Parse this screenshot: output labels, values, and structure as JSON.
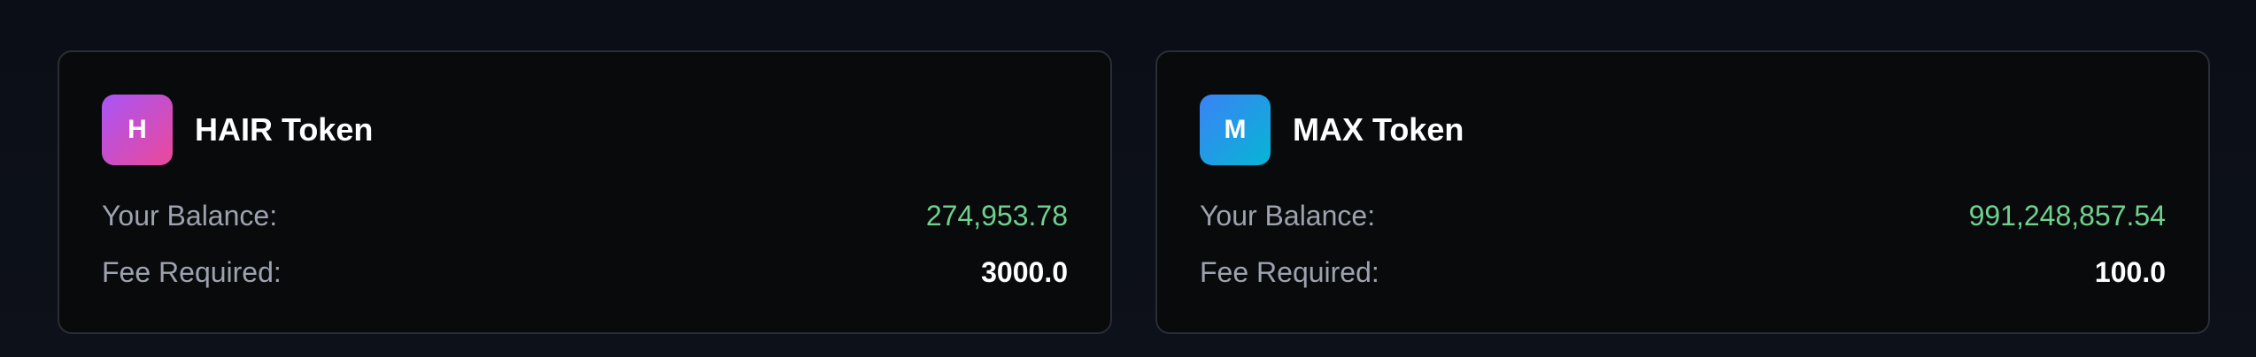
{
  "tokens": [
    {
      "badge_letter": "H",
      "badge_icon": "token-h-icon",
      "name": "HAIR Token",
      "balance_label": "Your Balance:",
      "balance_value": "274,953.78",
      "fee_label": "Fee Required:",
      "fee_value": "3000.0",
      "gradient": [
        "#a855f7",
        "#ec4899"
      ]
    },
    {
      "badge_letter": "M",
      "badge_icon": "token-m-icon",
      "name": "MAX Token",
      "balance_label": "Your Balance:",
      "balance_value": "991,248,857.54",
      "fee_label": "Fee Required:",
      "fee_value": "100.0",
      "gradient": [
        "#3b82f6",
        "#06b6d4"
      ]
    }
  ],
  "colors": {
    "page_background": "#0c0f17",
    "card_background": "#090a0c",
    "card_border": "#2a2d35",
    "label_text": "#9ca3af",
    "balance_text": "#6ed28f",
    "fee_text": "#ffffff"
  }
}
